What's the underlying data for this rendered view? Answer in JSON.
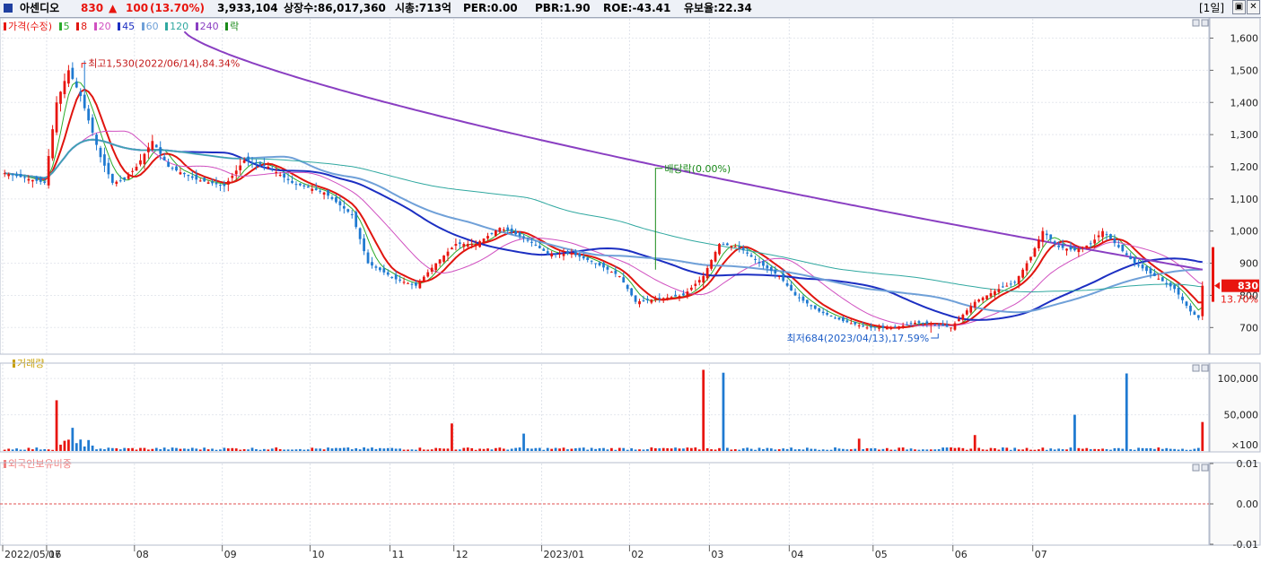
{
  "header": {
    "name": "아센디오",
    "price": "830",
    "change_arrow": "▲",
    "change": "100",
    "change_pct": "(13.70%)",
    "volume": "3,933,104",
    "shares": "상장수:86,017,360",
    "market_cap": "시총:713억",
    "per": "PER:0.00",
    "pbr": "PBR:1.90",
    "roe": "ROE:-43.41",
    "float": "유보율:22.34",
    "period_label": "[1일]"
  },
  "colors": {
    "up": "#e8150f",
    "down": "#1f7ad1",
    "ma5": "#2bab2b",
    "ma8": "#e0150f",
    "ma20": "#d050c0",
    "ma45": "#1c2fc2",
    "ma60": "#6fa0d8",
    "ma120": "#30a8a0",
    "ma240": "#8a3fc2"
  },
  "legend": {
    "price": "가격(수정)",
    "ma": [
      "5",
      "8",
      "20",
      "45",
      "60",
      "120",
      "240"
    ],
    "dividend": "락",
    "volume": "거래량",
    "foreign": "외국인보유비중"
  },
  "chart_data": [
    {
      "type": "candlestick",
      "title": "가격(수정)",
      "ylim": [
        620,
        1660
      ],
      "yticks": [
        700,
        800,
        900,
        1000,
        1100,
        1200,
        1300,
        1400,
        1500,
        1600
      ],
      "ytick_labels": [
        "700",
        "800",
        "900",
        "1,000",
        "1,100",
        "1,200",
        "1,300",
        "1,400",
        "1,500",
        "1,600"
      ],
      "x_labels": [
        "2022/05/16",
        "07",
        "08",
        "09",
        "10",
        "11",
        "12",
        "2023/01",
        "02",
        "03",
        "04",
        "05",
        "06",
        "07"
      ],
      "key_points": [
        {
          "day": 0,
          "close": 1180
        },
        {
          "day": 10,
          "close": 1150
        },
        {
          "day": 13,
          "close": 1400
        },
        {
          "day": 16,
          "close": 1500
        },
        {
          "day": 19,
          "close": 1420
        },
        {
          "day": 24,
          "close": 1230
        },
        {
          "day": 27,
          "close": 1150
        },
        {
          "day": 30,
          "close": 1160
        },
        {
          "day": 33,
          "close": 1200
        },
        {
          "day": 37,
          "close": 1280
        },
        {
          "day": 41,
          "close": 1200
        },
        {
          "day": 48,
          "close": 1160
        },
        {
          "day": 55,
          "close": 1140
        },
        {
          "day": 60,
          "close": 1220
        },
        {
          "day": 66,
          "close": 1200
        },
        {
          "day": 72,
          "close": 1150
        },
        {
          "day": 80,
          "close": 1120
        },
        {
          "day": 87,
          "close": 1050
        },
        {
          "day": 91,
          "close": 900
        },
        {
          "day": 98,
          "close": 850
        },
        {
          "day": 103,
          "close": 830
        },
        {
          "day": 108,
          "close": 900
        },
        {
          "day": 113,
          "close": 960
        },
        {
          "day": 118,
          "close": 960
        },
        {
          "day": 124,
          "close": 1010
        },
        {
          "day": 130,
          "close": 980
        },
        {
          "day": 136,
          "close": 930
        },
        {
          "day": 142,
          "close": 930
        },
        {
          "day": 148,
          "close": 900
        },
        {
          "day": 154,
          "close": 860
        },
        {
          "day": 158,
          "close": 780
        },
        {
          "day": 164,
          "close": 790
        },
        {
          "day": 170,
          "close": 800
        },
        {
          "day": 175,
          "close": 860
        },
        {
          "day": 179,
          "close": 960
        },
        {
          "day": 184,
          "close": 950
        },
        {
          "day": 189,
          "close": 900
        },
        {
          "day": 194,
          "close": 860
        },
        {
          "day": 198,
          "close": 800
        },
        {
          "day": 204,
          "close": 750
        },
        {
          "day": 210,
          "close": 720
        },
        {
          "day": 216,
          "close": 700
        },
        {
          "day": 222,
          "close": 698
        },
        {
          "day": 228,
          "close": 715
        },
        {
          "day": 233,
          "close": 710
        },
        {
          "day": 237,
          "close": 700
        },
        {
          "day": 243,
          "close": 780
        },
        {
          "day": 249,
          "close": 820
        },
        {
          "day": 253,
          "close": 840
        },
        {
          "day": 257,
          "close": 920
        },
        {
          "day": 260,
          "close": 1000
        },
        {
          "day": 264,
          "close": 950
        },
        {
          "day": 268,
          "close": 940
        },
        {
          "day": 272,
          "close": 960
        },
        {
          "day": 275,
          "close": 1000
        },
        {
          "day": 279,
          "close": 950
        },
        {
          "day": 283,
          "close": 900
        },
        {
          "day": 288,
          "close": 860
        },
        {
          "day": 293,
          "close": 820
        },
        {
          "day": 297,
          "close": 750
        },
        {
          "day": 299,
          "close": 730
        },
        {
          "day": 300,
          "close": 830
        }
      ],
      "moving_averages": [
        {
          "name": "5",
          "color": "#2bab2b",
          "width": 1
        },
        {
          "name": "8",
          "color": "#e0150f",
          "width": 2
        },
        {
          "name": "20",
          "color": "#d050c0",
          "width": 1
        },
        {
          "name": "45",
          "color": "#1c2fc2",
          "width": 2
        },
        {
          "name": "60",
          "color": "#6fa0d8",
          "width": 2
        },
        {
          "name": "120",
          "color": "#30a8a0",
          "width": 1
        },
        {
          "name": "240",
          "color": "#8a3fc2",
          "width": 2
        }
      ],
      "annotations": [
        {
          "text": "최고1,530(2022/06/14),84.34%",
          "day": 20,
          "value": 1530
        },
        {
          "text": "최저684(2023/04/13),17.59%",
          "day": 232,
          "value": 684
        },
        {
          "text": "배당락(0.00%)",
          "day": 163,
          "value": 880
        }
      ],
      "last_price_tag": "830",
      "last_change_tag": "13.70%"
    },
    {
      "type": "bar",
      "title": "거래량",
      "ylim": [
        0,
        120000
      ],
      "yticks": [
        100000,
        50000
      ],
      "ytick_labels": [
        "100,000",
        "50,000"
      ],
      "unit_label": "×100",
      "spikes": [
        {
          "day": 13,
          "value": 70000
        },
        {
          "day": 17,
          "value": 32000
        },
        {
          "day": 112,
          "value": 38000
        },
        {
          "day": 130,
          "value": 24000
        },
        {
          "day": 175,
          "value": 112000
        },
        {
          "day": 180,
          "value": 108000
        },
        {
          "day": 214,
          "value": 17000
        },
        {
          "day": 243,
          "value": 22000
        },
        {
          "day": 268,
          "value": 50000
        },
        {
          "day": 281,
          "value": 107000
        },
        {
          "day": 300,
          "value": 40000
        }
      ]
    },
    {
      "type": "line",
      "title": "외국인보유비중",
      "ylim": [
        -0.01,
        0.01
      ],
      "yticks": [
        0.01,
        0.0,
        -0.01
      ],
      "ytick_labels": [
        "0.01",
        "0.00",
        "-0.01"
      ],
      "values": [
        0.0
      ]
    }
  ]
}
